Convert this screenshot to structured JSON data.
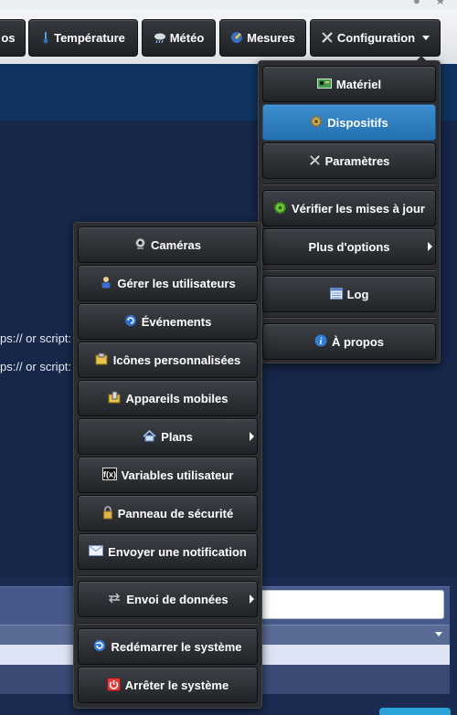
{
  "nav": {
    "partial_label": "os",
    "temperature": {
      "label": "Température",
      "icon": "thermometer-icon"
    },
    "weather": {
      "label": "Météo",
      "icon": "cloud-rain-icon"
    },
    "measures": {
      "label": "Mesures",
      "icon": "gauge-icon"
    },
    "configuration": {
      "label": "Configuration",
      "icon": "tools-icon"
    }
  },
  "page": {
    "line1": "ps:// or script:",
    "line2": "ps:// or script:"
  },
  "config_menu": {
    "items": [
      {
        "label": "Matériel",
        "icon": "hardware-board-icon"
      },
      {
        "label": "Dispositifs",
        "icon": "gear-icon"
      },
      {
        "label": "Paramètres",
        "icon": "tools-icon"
      },
      {
        "label": "Vérifier les mises à jour",
        "icon": "update-gear-icon"
      },
      {
        "label": "Plus d'options",
        "icon": ""
      },
      {
        "label": "Log",
        "icon": "log-list-icon"
      },
      {
        "label": "À propos",
        "icon": "info-icon"
      }
    ]
  },
  "more_menu": {
    "items": [
      {
        "label": "Caméras",
        "icon": "webcam-icon"
      },
      {
        "label": "Gérer les utilisateurs",
        "icon": "users-icon"
      },
      {
        "label": "Événements",
        "icon": "events-icon"
      },
      {
        "label": "Icônes personnalisées",
        "icon": "custom-icons-icon"
      },
      {
        "label": "Appareils mobiles",
        "icon": "mobile-devices-icon"
      },
      {
        "label": "Plans",
        "icon": "house-icon"
      },
      {
        "label": "Variables utilisateur",
        "icon": "fx-variable-icon"
      },
      {
        "label": "Panneau de sécurité",
        "icon": "security-lock-icon"
      },
      {
        "label": "Envoyer une notification",
        "icon": "envelope-icon"
      },
      {
        "label": "Envoi de données",
        "icon": "data-transfer-icon"
      },
      {
        "label": "Redémarrer le système",
        "icon": "restart-icon"
      },
      {
        "label": "Arrêter le système",
        "icon": "power-off-icon"
      }
    ]
  }
}
